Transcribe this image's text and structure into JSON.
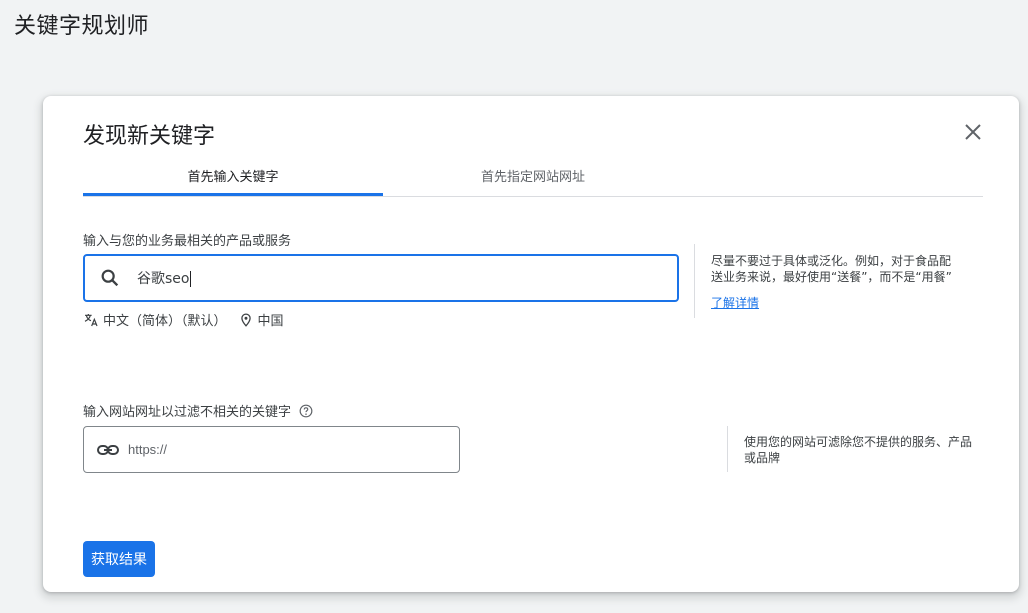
{
  "page": {
    "title": "关键字规划师"
  },
  "dialog": {
    "title": "发现新关键字",
    "tabs": [
      {
        "label": "首先输入关键字",
        "active": true
      },
      {
        "label": "首先指定网站网址",
        "active": false
      }
    ],
    "keywords": {
      "label": "输入与您的业务最相关的产品或服务",
      "value": "谷歌seo",
      "language": "中文（简体）（默认）",
      "location": "中国",
      "hint": "尽量不要过于具体或泛化。例如，对于食品配送业务来说，最好使用“送餐”，而不是“用餐”",
      "learn_more": "了解详情"
    },
    "website": {
      "label": "输入网站网址以过滤不相关的关键字",
      "placeholder": "https://",
      "hint": "使用您的网站可滤除您不提供的服务、产品或品牌"
    },
    "submit_label": "获取结果"
  },
  "colors": {
    "accent": "#1a73e8",
    "background": "#f1f3f4",
    "text": "#202124"
  },
  "icons": [
    "close-icon",
    "search-icon",
    "translate-icon",
    "location-pin-icon",
    "help-icon",
    "link-icon"
  ]
}
